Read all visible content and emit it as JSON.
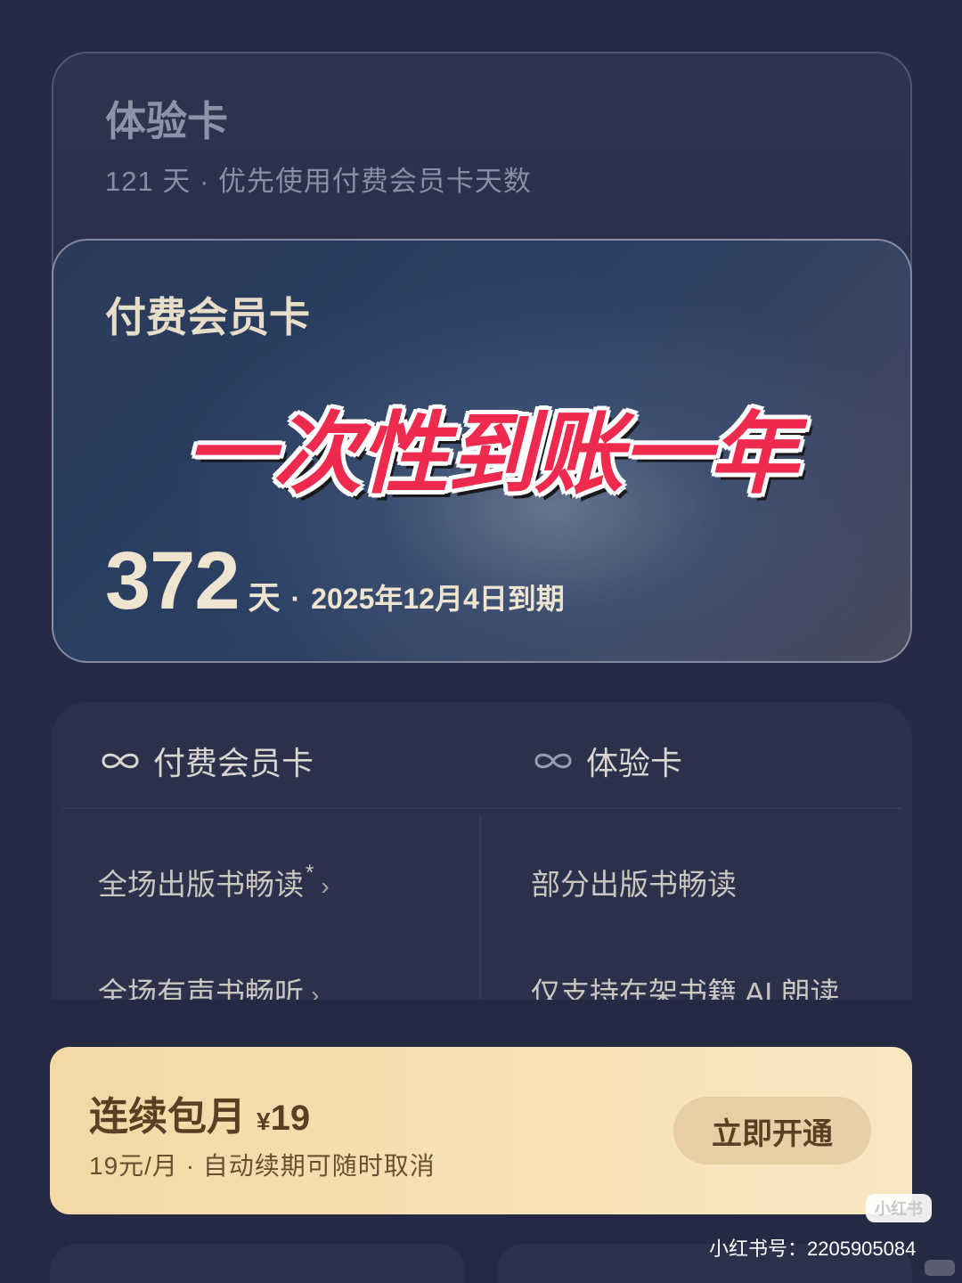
{
  "trial_card": {
    "title": "体验卡",
    "subtitle": "121 天 · 优先使用付费会员卡天数"
  },
  "paid_card": {
    "title": "付费会员卡",
    "overlay_caption": "一次性到账一年",
    "days": "372",
    "days_unit": "天",
    "separator": "·",
    "expiry": "2025年12月4日到期"
  },
  "compare": {
    "columns": [
      {
        "icon": "infinity-icon",
        "label": "付费会员卡"
      },
      {
        "icon": "infinity-icon",
        "label": "体验卡"
      }
    ],
    "paid_features": [
      {
        "label": "全场出版书畅读",
        "star": "*",
        "chevron": "›"
      },
      {
        "label": "全场有声书畅听",
        "chevron": "›"
      }
    ],
    "trial_features": [
      {
        "label": "部分出版书畅读"
      },
      {
        "label": "仅支持在架书籍 AI 朗读"
      }
    ]
  },
  "subscribe": {
    "title": "连续包月",
    "currency": "¥",
    "price": "19",
    "description": "19元/月 · 自动续期可随时取消",
    "button_label": "立即开通"
  },
  "watermark": {
    "logo": "小红书",
    "account": "小红书号：2205905084"
  },
  "colors": {
    "background": "#262a44",
    "accent_gold": "#f4d8a6",
    "caption_red": "#ee2b4f"
  }
}
